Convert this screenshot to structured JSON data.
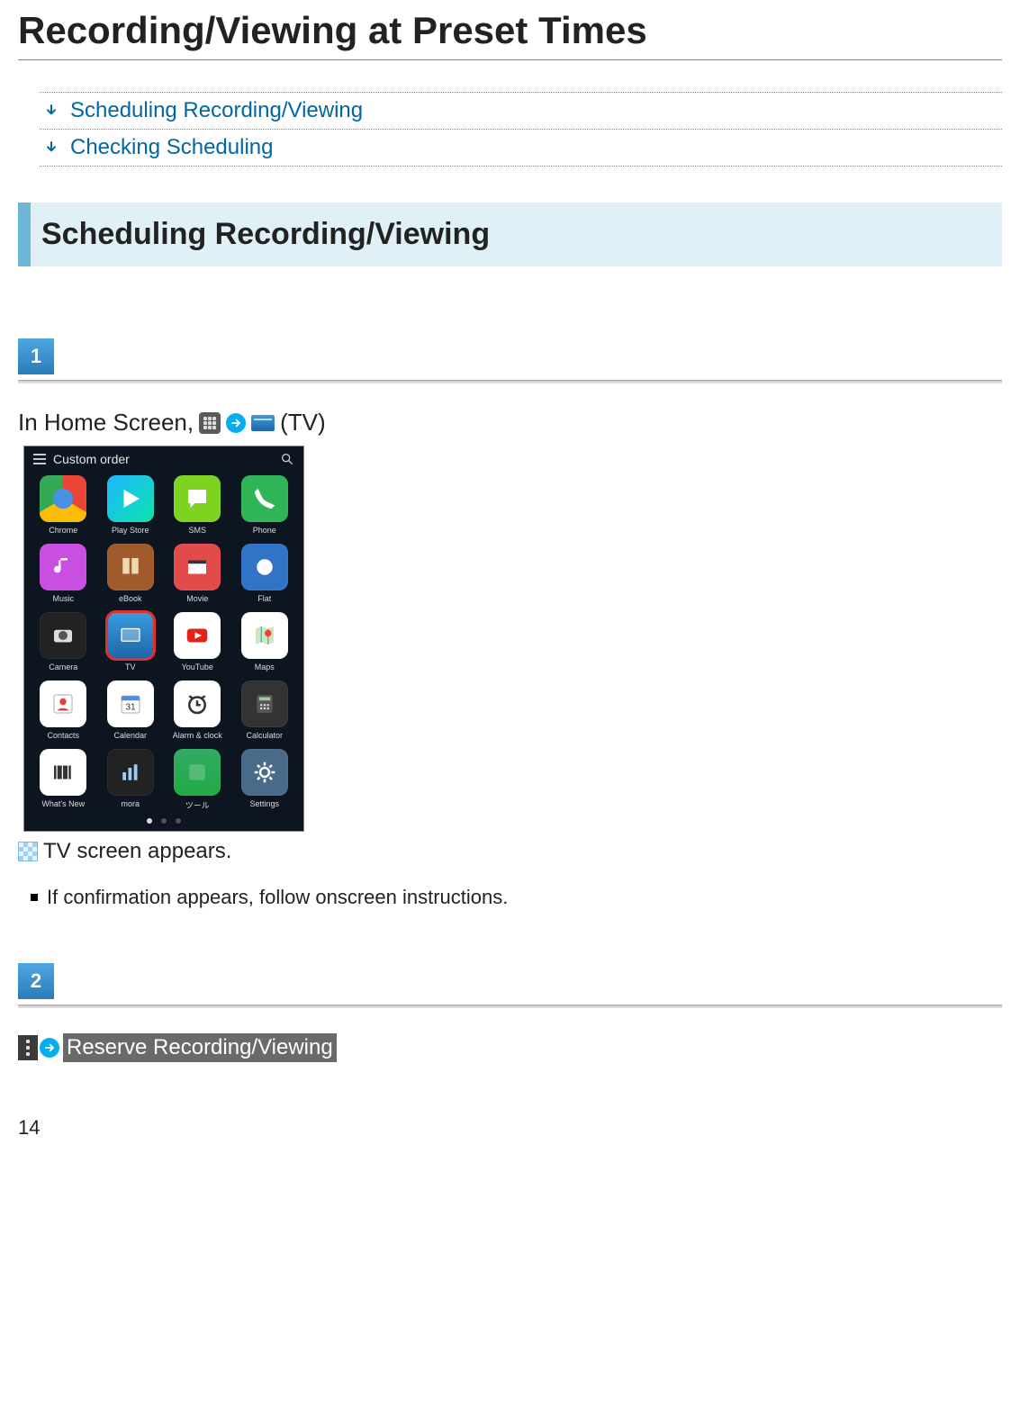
{
  "page": {
    "title": "Recording/Viewing at Preset Times",
    "number": "14"
  },
  "toc": [
    {
      "label": "Scheduling Recording/Viewing"
    },
    {
      "label": "Checking Scheduling"
    }
  ],
  "section1": {
    "title": "Scheduling Recording/Viewing"
  },
  "step1": {
    "badge": "1",
    "prefix": "In Home Screen,",
    "suffix": "(TV)",
    "result": "TV screen appears.",
    "note": "If confirmation appears, follow onscreen instructions."
  },
  "phone": {
    "topbar_label": "Custom order",
    "apps": [
      {
        "label": "Chrome"
      },
      {
        "label": "Play Store"
      },
      {
        "label": "SMS"
      },
      {
        "label": "Phone"
      },
      {
        "label": "Music"
      },
      {
        "label": "eBook"
      },
      {
        "label": "Movie"
      },
      {
        "label": "Flat"
      },
      {
        "label": "Camera"
      },
      {
        "label": "TV"
      },
      {
        "label": "YouTube"
      },
      {
        "label": "Maps"
      },
      {
        "label": "Contacts"
      },
      {
        "label": "Calendar"
      },
      {
        "label": "Alarm & clock"
      },
      {
        "label": "Calculator"
      },
      {
        "label": "What's New"
      },
      {
        "label": "mora"
      },
      {
        "label": "ツール"
      },
      {
        "label": "Settings"
      }
    ]
  },
  "step2": {
    "badge": "2",
    "reserve_label": "Reserve Recording/Viewing"
  }
}
